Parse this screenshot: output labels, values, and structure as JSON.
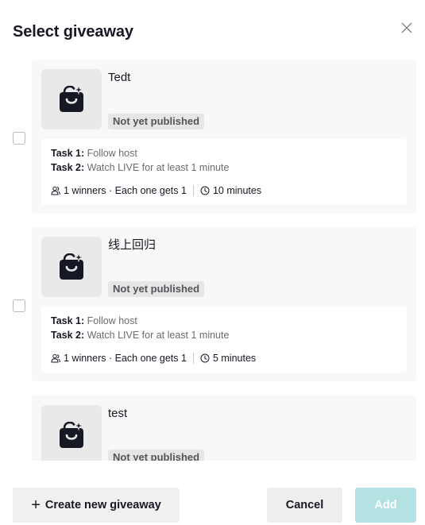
{
  "dialog": {
    "title": "Select giveaway",
    "close_icon": "close-icon"
  },
  "giveaways": [
    {
      "name": "Tedt",
      "status": "Not yet published",
      "task1_label": "Task 1:",
      "task1_value": "Follow host",
      "task2_label": "Task 2:",
      "task2_value": "Watch LIVE for at least 1 minute",
      "winners": "1 winners · Each one gets 1",
      "duration": "10 minutes"
    },
    {
      "name": "线上回归",
      "status": "Not yet published",
      "task1_label": "Task 1:",
      "task1_value": "Follow host",
      "task2_label": "Task 2:",
      "task2_value": "Watch LIVE for at least 1 minute",
      "winners": "1 winners · Each one gets 1",
      "duration": "5 minutes"
    },
    {
      "name": "test",
      "status": "Not yet published"
    }
  ],
  "footer": {
    "create_label": "Create new giveaway",
    "cancel_label": "Cancel",
    "add_label": "Add"
  },
  "colors": {
    "primary_disabled": "#b4e2e2",
    "text": "#161823",
    "card_bg": "#f8f8f8"
  },
  "icons": {
    "product": "shopping-bag-icon",
    "winners": "people-icon",
    "duration": "clock-icon",
    "create": "plus-icon"
  }
}
